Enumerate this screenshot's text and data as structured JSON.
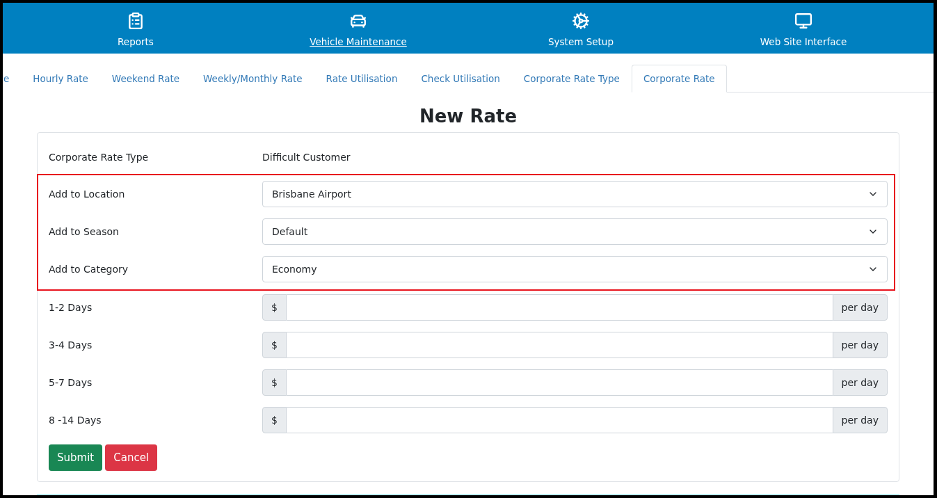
{
  "nav": [
    {
      "label": "Reports",
      "hovered": false
    },
    {
      "label": "Vehicle Maintenance",
      "hovered": true
    },
    {
      "label": "System Setup",
      "hovered": false
    },
    {
      "label": "Web Site Interface",
      "hovered": false
    }
  ],
  "tabs": [
    {
      "label": "e",
      "selected": false
    },
    {
      "label": "Hourly Rate",
      "selected": false
    },
    {
      "label": "Weekend Rate",
      "selected": false
    },
    {
      "label": "Weekly/Monthly Rate",
      "selected": false
    },
    {
      "label": "Rate Utilisation",
      "selected": false
    },
    {
      "label": "Check Utilisation",
      "selected": false
    },
    {
      "label": "Corporate Rate Type",
      "selected": false
    },
    {
      "label": "Corporate Rate",
      "selected": true
    }
  ],
  "heading": "New Rate",
  "form": {
    "sections": [
      {
        "highlighted": false,
        "rows": [
          {
            "kind": "text",
            "label": "Corporate Rate Type",
            "value": "Difficult Customer"
          }
        ]
      },
      {
        "highlighted": true,
        "rows": [
          {
            "kind": "select",
            "label": "Add to Location",
            "value": "Brisbane Airport"
          },
          {
            "kind": "select",
            "label": "Add to Season",
            "value": "Default"
          },
          {
            "kind": "select",
            "label": "Add to Category",
            "value": "Economy"
          }
        ]
      },
      {
        "highlighted": false,
        "rows": [
          {
            "kind": "money",
            "label": "1-2 Days",
            "prefix": "$",
            "suffix": "per day"
          },
          {
            "kind": "money",
            "label": "3-4 Days",
            "prefix": "$",
            "suffix": "per day"
          },
          {
            "kind": "money",
            "label": "5-7 Days",
            "prefix": "$",
            "suffix": "per day"
          },
          {
            "kind": "money",
            "label": "8 -14 Days",
            "prefix": "$",
            "suffix": "per day"
          }
        ]
      }
    ],
    "buttons": [
      {
        "kind": "submit",
        "label": "Submit"
      },
      {
        "kind": "cancel",
        "label": "Cancel"
      }
    ]
  }
}
